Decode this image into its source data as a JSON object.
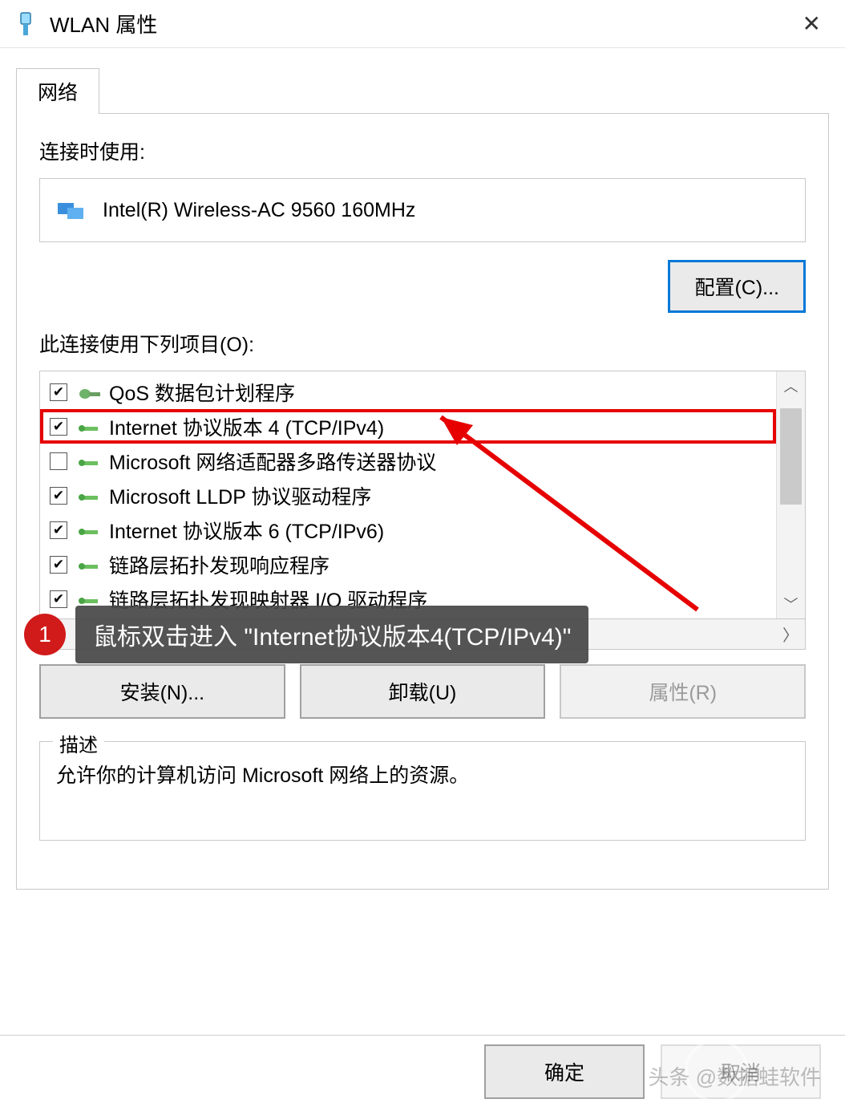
{
  "window": {
    "title": "WLAN 属性"
  },
  "tab": {
    "network": "网络"
  },
  "connection": {
    "label": "连接时使用:",
    "adapter": "Intel(R) Wireless-AC 9560 160MHz",
    "configure_btn": "配置(C)..."
  },
  "components": {
    "label": "此连接使用下列项目(O):",
    "items": [
      {
        "checked": true,
        "label": "QoS 数据包计划程序"
      },
      {
        "checked": true,
        "label": "Internet 协议版本 4 (TCP/IPv4)",
        "highlight": true
      },
      {
        "checked": false,
        "label": "Microsoft 网络适配器多路传送器协议"
      },
      {
        "checked": true,
        "label": "Microsoft LLDP 协议驱动程序"
      },
      {
        "checked": true,
        "label": "Internet 协议版本 6 (TCP/IPv6)"
      },
      {
        "checked": true,
        "label": "链路层拓扑发现响应程序"
      },
      {
        "checked": true,
        "label": "链路层拓扑发现映射器 I/O 驱动程序"
      }
    ]
  },
  "actions": {
    "install": "安装(N)...",
    "uninstall": "卸载(U)",
    "properties": "属性(R)"
  },
  "description": {
    "label": "描述",
    "text": "允许你的计算机访问 Microsoft 网络上的资源。"
  },
  "footer": {
    "ok": "确定",
    "cancel": "取消"
  },
  "annotation": {
    "badge": "1",
    "text": "鼠标双击进入 \"Internet协议版本4(TCP/IPv4)\""
  },
  "watermark": "头条 @数据蛙软件"
}
